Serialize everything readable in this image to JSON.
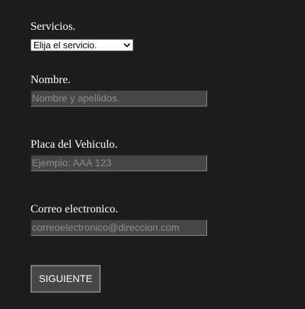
{
  "servicios": {
    "label": "Servicios.",
    "selected_option": "Elija el servicio.",
    "icon": "chevron-down-icon"
  },
  "nombre": {
    "label": "Nombre.",
    "placeholder": "Nombre y apellidos."
  },
  "placa": {
    "label": "Placa del Vehiculo.",
    "placeholder": "Ejemplo: AAA 123"
  },
  "correo": {
    "label": "Correo electronico.",
    "placeholder": "correoelectronico@direccion.com"
  },
  "submit": {
    "label": "SIGUIENTE"
  },
  "colors": {
    "background": "#1d1d1d",
    "input_background": "#474747",
    "label_text": "#ffffff",
    "placeholder_text": "#8c8c8c"
  }
}
